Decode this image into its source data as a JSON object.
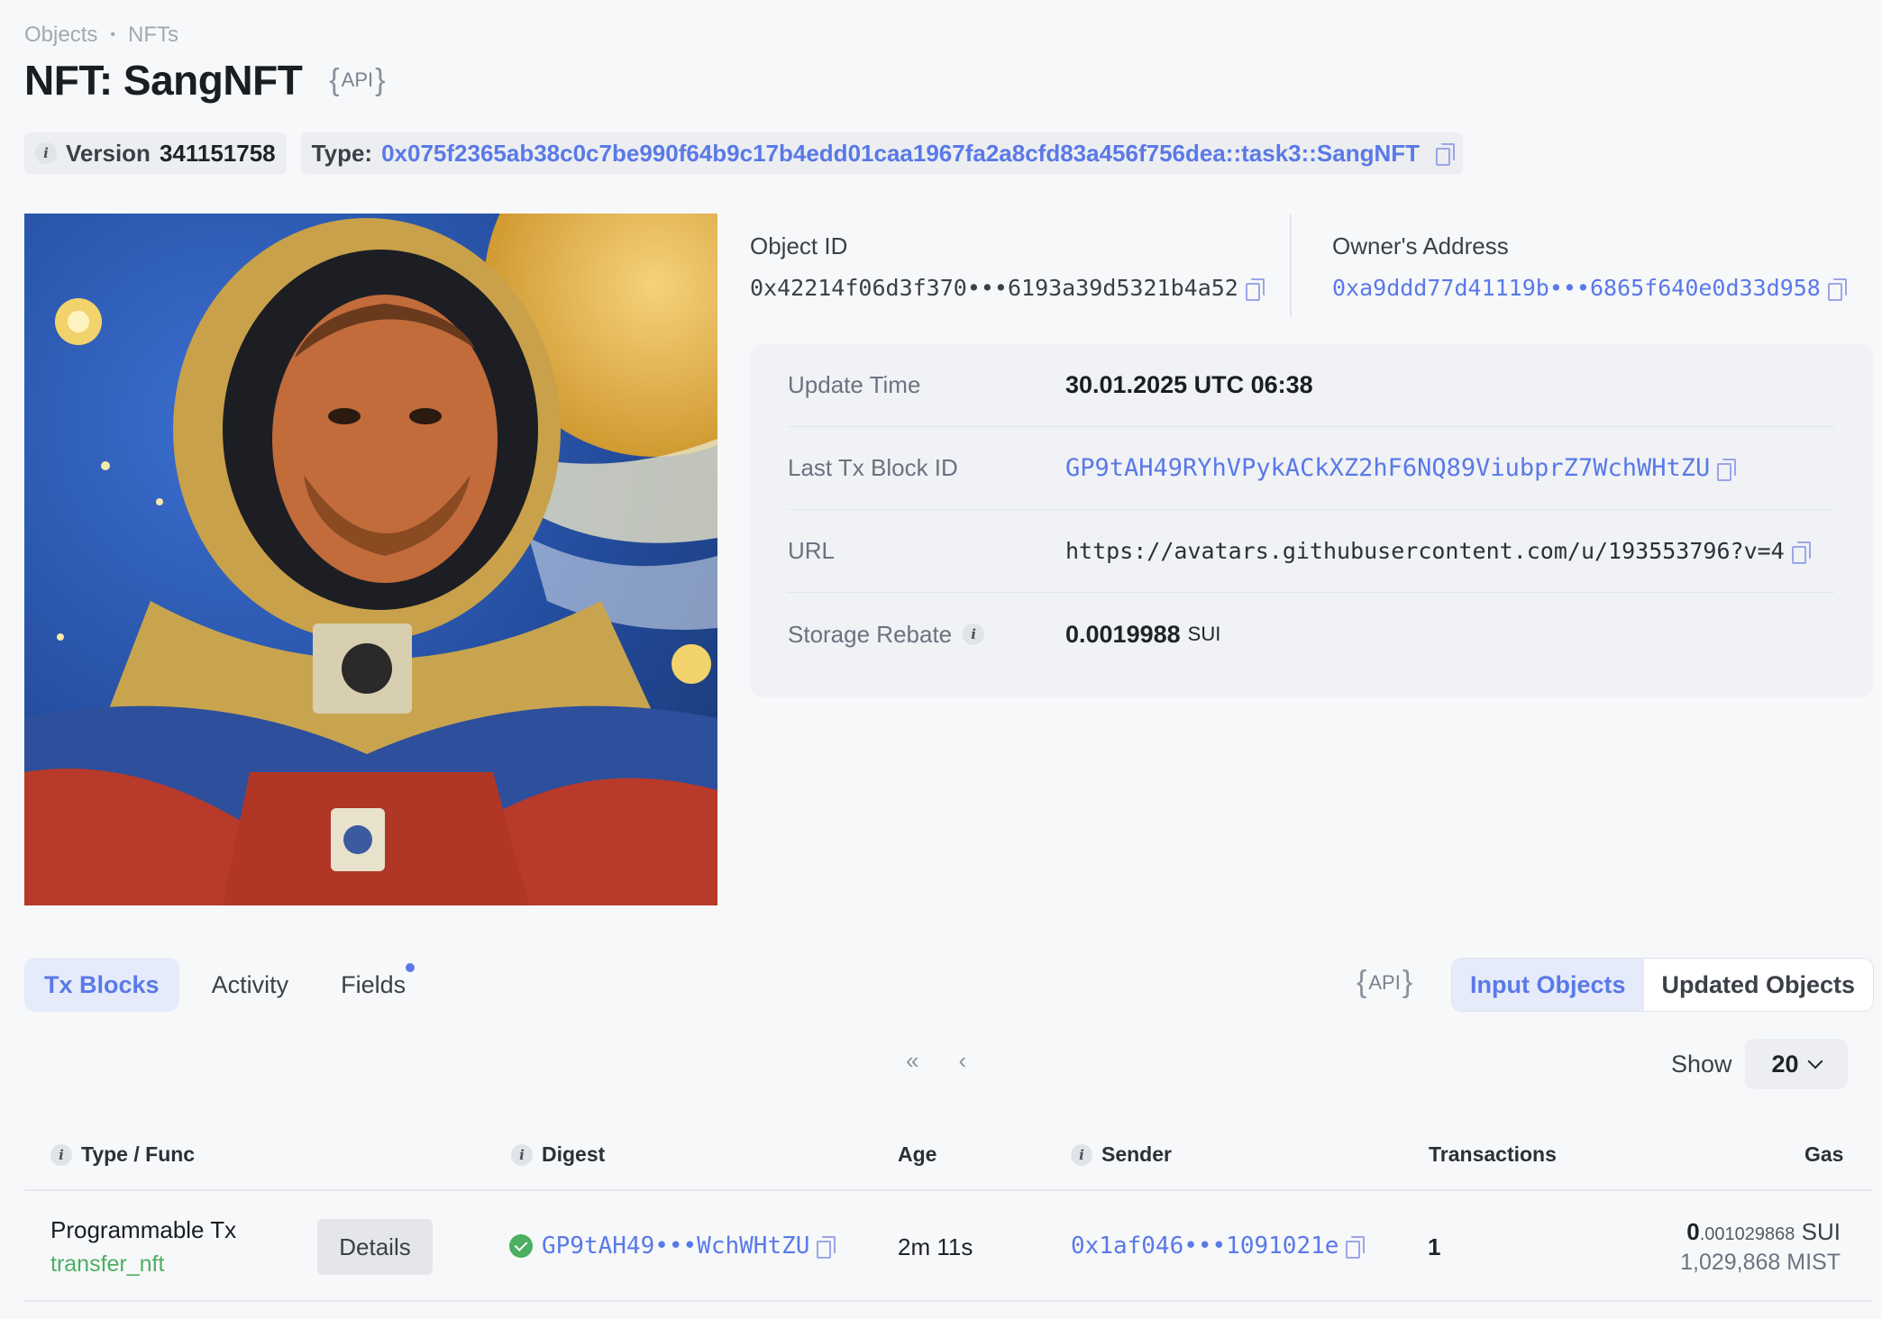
{
  "breadcrumb": {
    "item1": "Objects",
    "separator": "•",
    "item2": "NFTs"
  },
  "header": {
    "title": "NFT: SangNFT",
    "api_label": "API",
    "brace_open": "{",
    "brace_close": "}"
  },
  "chips": {
    "version_label": "Version",
    "version_value": "341151758",
    "type_label": "Type:",
    "type_value": "0x075f2365ab38c0c7be990f64b9c17b4edd01caa1967fa2a8cfd83a456f756dea::task3::SangNFT"
  },
  "object": {
    "id_label": "Object ID",
    "id_value": "0x42214f06d3f370•••6193a39d5321b4a52",
    "owner_label": "Owner's Address",
    "owner_value": "0xa9ddd77d41119b•••6865f640e0d33d958"
  },
  "details": {
    "update_time_label": "Update Time",
    "update_time_value": "30.01.2025 UTC 06:38",
    "last_tx_label": "Last Tx Block ID",
    "last_tx_value": "GP9tAH49RYhVPykACkXZ2hF6NQ89ViubprZ7WchWHtZU",
    "url_label": "URL",
    "url_value": "https://avatars.githubusercontent.com/u/193553796?v=4",
    "rebate_label": "Storage Rebate",
    "rebate_value": "0.0019988",
    "rebate_unit": "SUI"
  },
  "tabs": {
    "tx_blocks": "Tx Blocks",
    "activity": "Activity",
    "fields": "Fields"
  },
  "toggle": {
    "input": "Input Objects",
    "updated": "Updated Objects"
  },
  "pager": {
    "first": "«",
    "prev": "‹",
    "show_label": "Show",
    "show_value": "20"
  },
  "table": {
    "headers": {
      "type_func": "Type / Func",
      "digest": "Digest",
      "age": "Age",
      "sender": "Sender",
      "transactions": "Transactions",
      "gas": "Gas"
    },
    "rows": [
      {
        "type": "Programmable Tx",
        "func": "transfer_nft",
        "details": "Details",
        "digest": "GP9tAH49•••WchWHtZU",
        "age": "2m 11s",
        "sender": "0x1af046•••1091021e",
        "transactions": "1",
        "gas_int": "0",
        "gas_frac": ".001029868",
        "gas_unit": "SUI",
        "gas_mist": "1,029,868 MIST"
      }
    ]
  },
  "colors": {
    "accent": "#5a79e8",
    "success": "#4caf62",
    "background": "#f7f8f9"
  },
  "icons": {
    "info": "info-icon",
    "copy": "copy-icon",
    "check": "check-circle-icon",
    "chevron": "chevron-down-icon"
  }
}
